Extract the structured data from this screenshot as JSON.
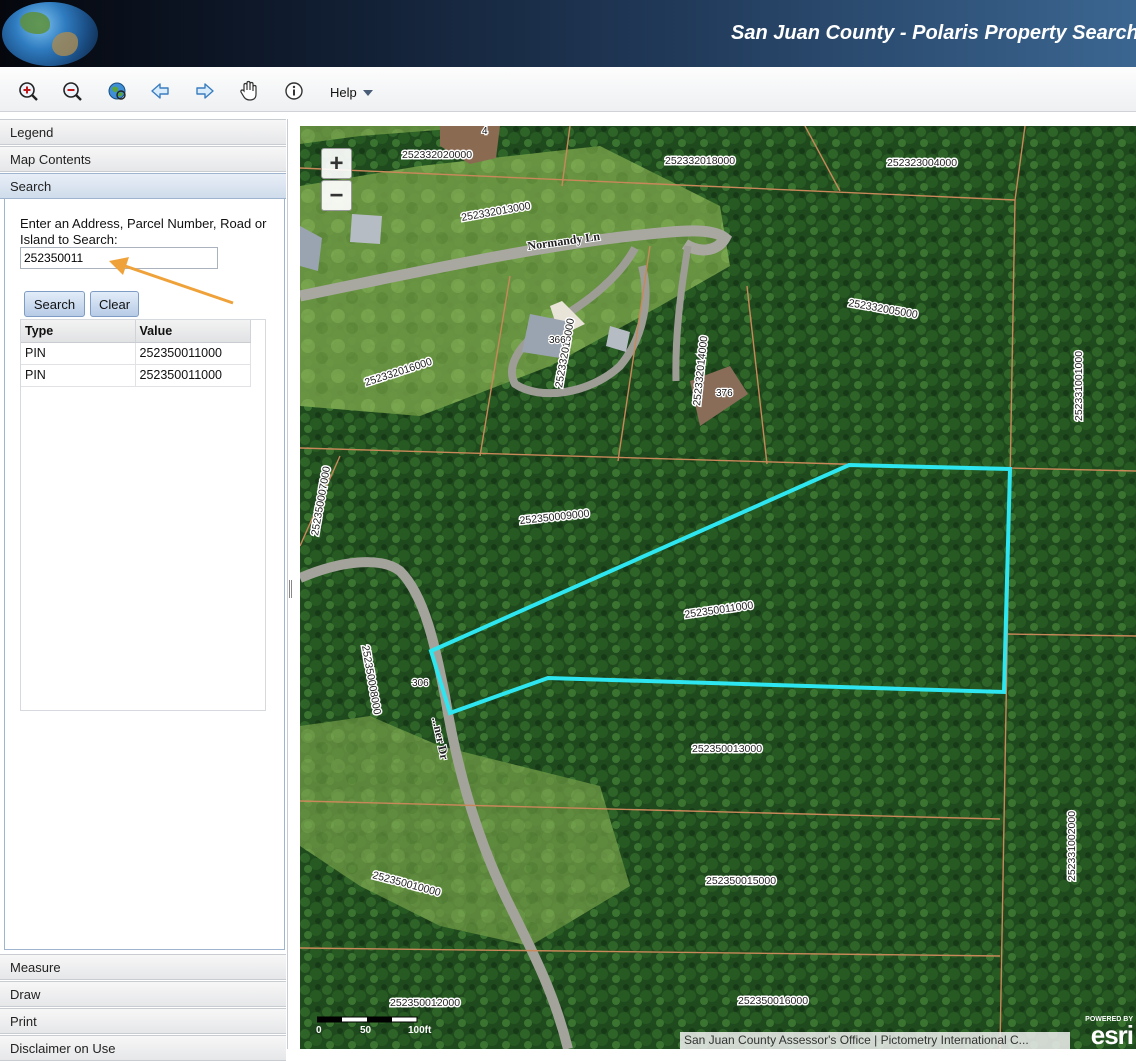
{
  "header": {
    "title": "San Juan County - Polaris Property Search"
  },
  "toolbar": {
    "buttons": [
      {
        "name": "zoom-in"
      },
      {
        "name": "zoom-out"
      },
      {
        "name": "full-extent"
      },
      {
        "name": "previous-extent"
      },
      {
        "name": "next-extent"
      },
      {
        "name": "pan"
      },
      {
        "name": "identify"
      }
    ],
    "help_label": "Help"
  },
  "sidebar": {
    "panels": {
      "legend": "Legend",
      "map_contents": "Map Contents",
      "search": "Search",
      "measure": "Measure",
      "draw": "Draw",
      "print": "Print",
      "disclaimer": "Disclaimer on Use"
    },
    "search": {
      "prompt": "Enter an Address, Parcel Number, Road or Island to Search:",
      "input_value": "252350011",
      "search_label": "Search",
      "clear_label": "Clear",
      "columns": [
        "Type",
        "Value"
      ],
      "rows": [
        {
          "type": "PIN",
          "value": "252350011000"
        },
        {
          "type": "PIN",
          "value": "252350011000"
        }
      ]
    }
  },
  "map": {
    "zoom_in": "+",
    "zoom_out": "−",
    "selected_parcel_color": "#2ee6f0",
    "parcel_line_color": "#c8885a",
    "annotation_arrow_color": "#f0a23a",
    "road_labels": {
      "normandy": "Normandy Ln",
      "lower": "...ner Dr"
    },
    "address_labels": {
      "a366": "366",
      "a376": "376",
      "a306": "306",
      "a4": "4"
    },
    "parcel_labels": {
      "p252332020000": "252332020000",
      "p252332018000": "252332018000",
      "p252323004000": "252323004000",
      "p252332013000": "252332013000",
      "p252332016000": "252332016000",
      "p252332015000": "252332015000",
      "p252332014000": "252332014000",
      "p252332005000": "252332005000",
      "p252331001000": "252331001000",
      "p252350007000": "252350007000",
      "p252350009000": "252350009000",
      "p252350011000": "252350011000",
      "p252350008000": "252350008000",
      "p252350013000": "252350013000",
      "p252331002000": "252331002000",
      "p252350010000": "252350010000",
      "p252350015000": "252350015000",
      "p252350012000": "252350012000",
      "p252350016000": "252350016000"
    },
    "scale": {
      "l0": "0",
      "l50": "50",
      "l100": "100ft"
    },
    "attribution": "San Juan County Assessor's Office | Pictometry International C...",
    "esri": {
      "powered": "POWERED BY",
      "word": "esri"
    }
  }
}
